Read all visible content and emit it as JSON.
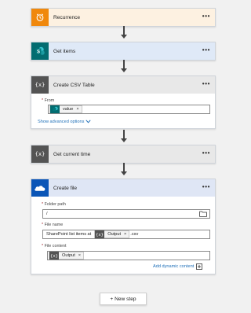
{
  "steps": {
    "recurrence": {
      "title": "Recurrence",
      "menu": "•••",
      "color": "#f0880c"
    },
    "get_items": {
      "title": "Get items",
      "menu": "•••",
      "color": "#036c70"
    },
    "create_csv": {
      "title": "Create CSV Table",
      "menu": "•••",
      "from_label": "From",
      "required_mark": "*",
      "from_token": "value",
      "token_remove": "×",
      "advanced_link": "Show advanced options"
    },
    "get_time": {
      "title": "Get current time",
      "menu": "•••"
    },
    "create_file": {
      "title": "Create file",
      "menu": "•••",
      "required_mark": "*",
      "folder_label": "Folder path",
      "folder_value": "/",
      "filename_label": "File name",
      "filename_prefix": "SharePoint list items at",
      "filename_token": "Output",
      "filename_suffix": ".csv",
      "content_label": "File content",
      "content_token": "Output",
      "token_remove": "×",
      "dynamic_link": "Add dynamic content"
    }
  },
  "new_step_label": "+ New step"
}
